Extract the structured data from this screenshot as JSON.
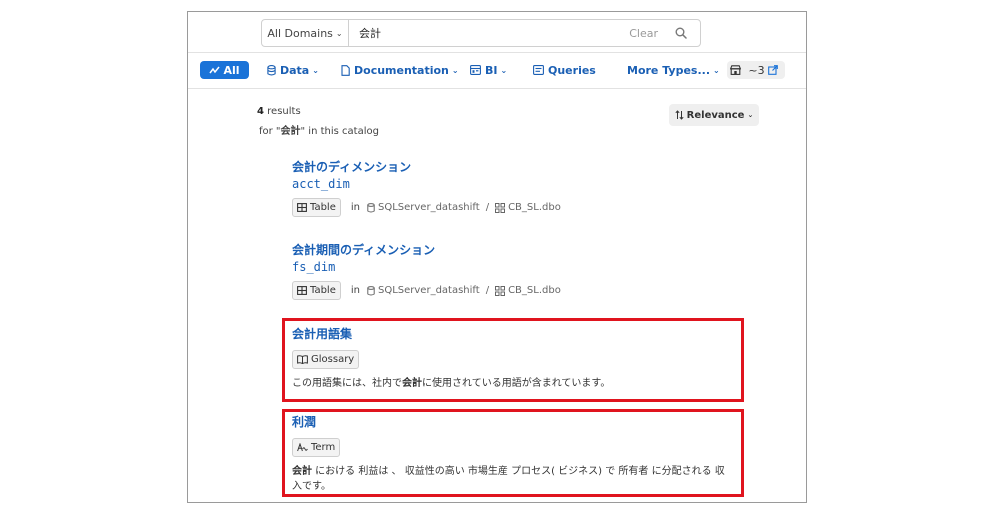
{
  "search": {
    "domain_label": "All Domains",
    "query": "会計",
    "clear_label": "Clear"
  },
  "type_bar": {
    "all": "All",
    "data": "Data",
    "documentation": "Documentation",
    "bi": "BI",
    "queries": "Queries",
    "more_types": "More Types...",
    "external_count": "~3"
  },
  "results_header": {
    "count": "4",
    "count_suffix": "results",
    "for_prefix": "for \"",
    "query": "会計",
    "for_suffix": "\" in this catalog",
    "sort_label": "Relevance"
  },
  "results": [
    {
      "title": "会計のディメンション",
      "subtitle": "acct_dim",
      "type_label": "Table",
      "in_label": "in",
      "database": "SQLServer_datashift",
      "schema": "CB_SL.dbo"
    },
    {
      "title": "会計期間のディメンション",
      "subtitle": "fs_dim",
      "type_label": "Table",
      "in_label": "in",
      "database": "SQLServer_datashift",
      "schema": "CB_SL.dbo"
    },
    {
      "title": "会計用語集",
      "type_label": "Glossary",
      "desc_pre": "この用語集には、社内で",
      "desc_bold": "会計",
      "desc_post": "に使用されている用語が含まれています。"
    },
    {
      "title": "利潤",
      "type_label": "Term",
      "desc_bold": "会計",
      "desc_post": " における 利益は 、 収益性の高い 市場生産 プロセス( ビジネス) で 所有者 に分配される 収入です。"
    }
  ],
  "colors": {
    "link": "#1a5fb4",
    "accent": "#1a73d8",
    "highlight_border": "#e0141e"
  }
}
